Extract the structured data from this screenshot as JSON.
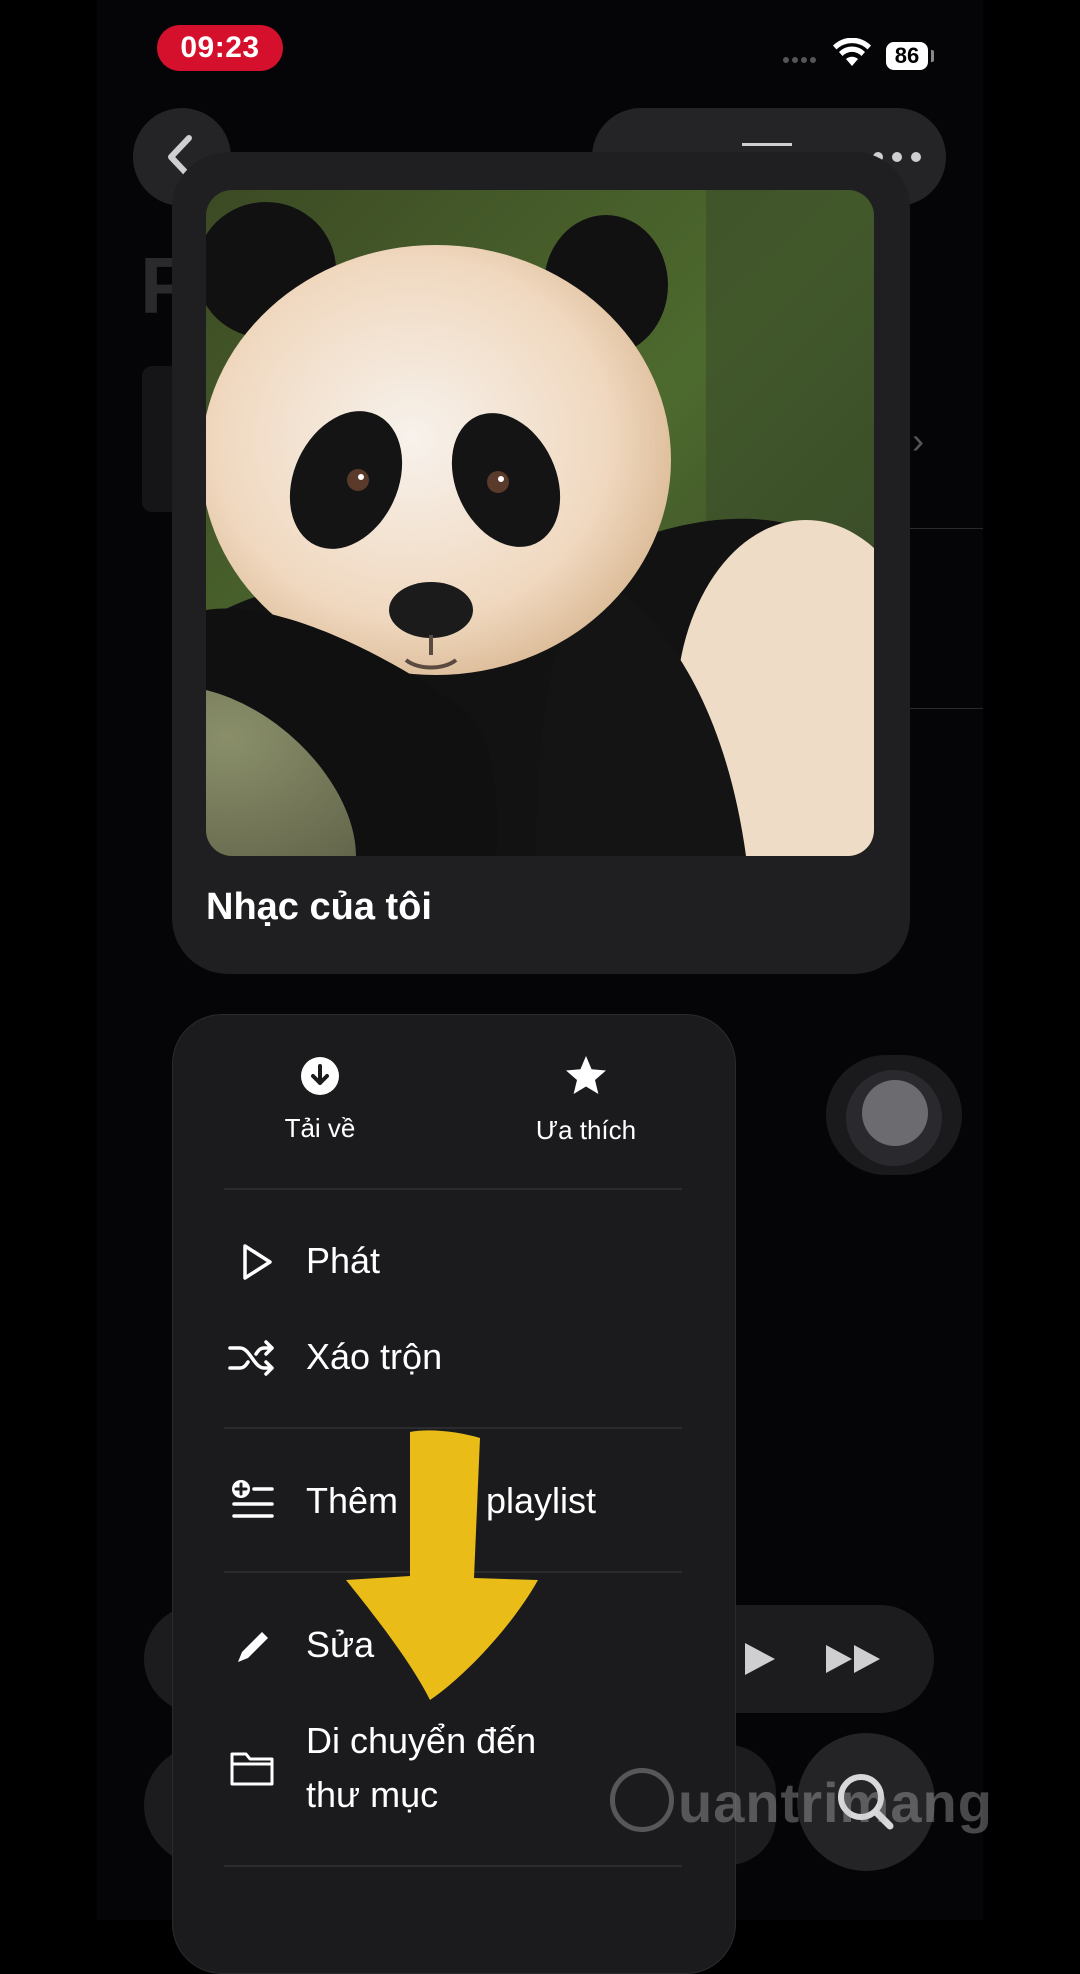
{
  "status_bar": {
    "time": "09:23",
    "battery": "86"
  },
  "background": {
    "title_partial": "P"
  },
  "card": {
    "title": "Nhạc của tôi"
  },
  "menu": {
    "top_actions": [
      {
        "label": "Tải về",
        "icon": "download-circle-icon"
      },
      {
        "label": "Ưa thích",
        "icon": "star-icon"
      }
    ],
    "items": [
      {
        "label": "Phát",
        "icon": "play-icon"
      },
      {
        "label": "Xáo trộn",
        "icon": "shuffle-icon"
      },
      {
        "label_visible_start": "Thêm",
        "label_visible_end": "playlist",
        "icon": "add-to-list-icon"
      },
      {
        "label": "Sửa",
        "icon": "pencil-icon"
      },
      {
        "label_line1": "Di chuyển đến",
        "label_line2": "thư mục",
        "icon": "folder-icon"
      }
    ]
  },
  "annotation": {
    "arrow_color": "#f5c518"
  },
  "watermark": {
    "text": "uantrimang"
  }
}
